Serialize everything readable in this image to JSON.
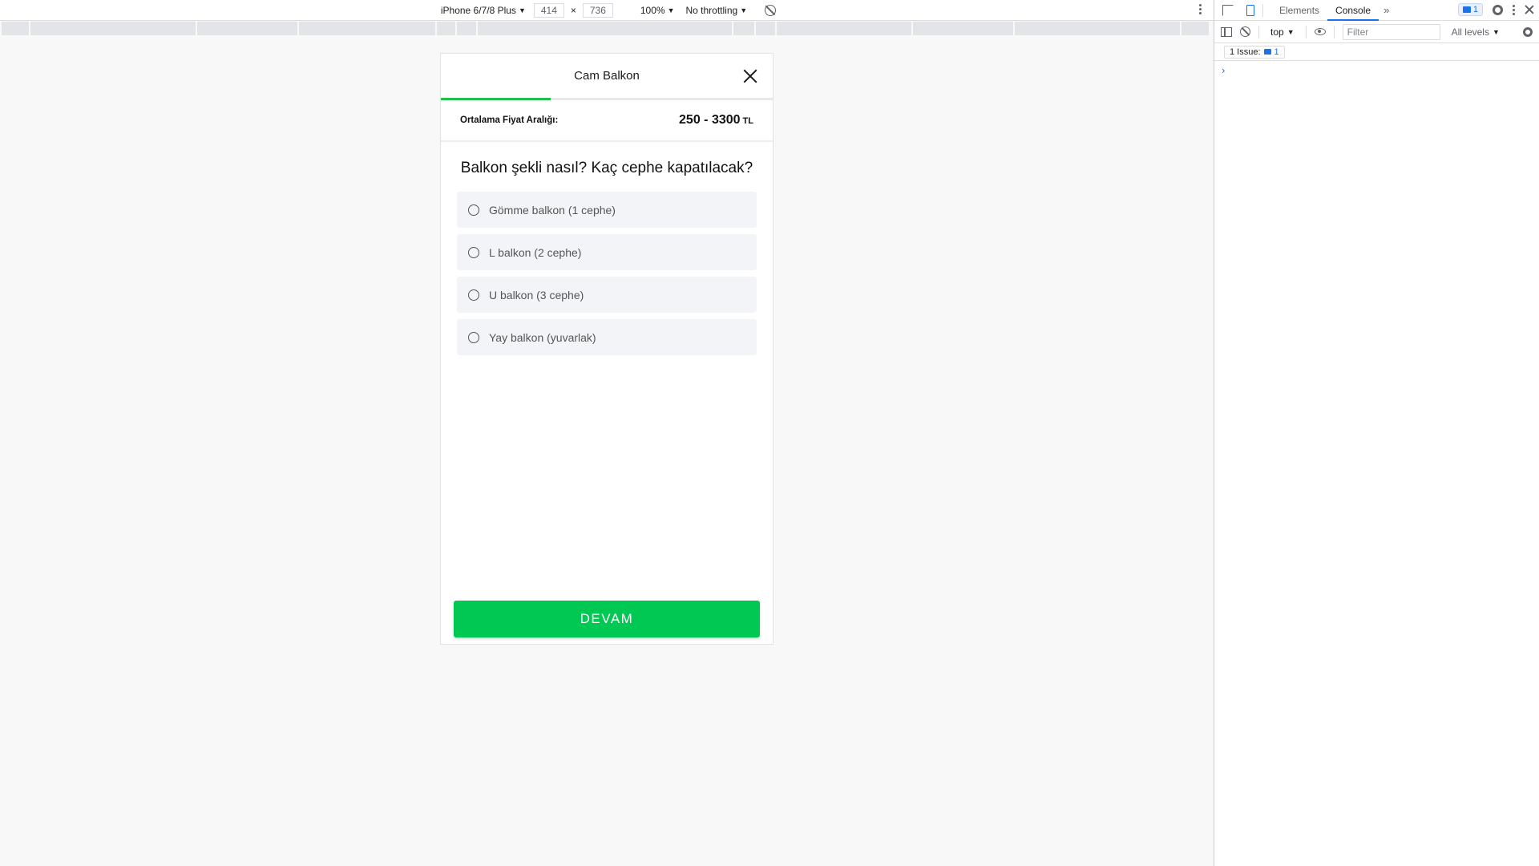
{
  "device_toolbar": {
    "device": "iPhone 6/7/8 Plus",
    "width": "414",
    "times": "×",
    "height": "736",
    "zoom": "100%",
    "throttling": "No throttling"
  },
  "modal": {
    "title": "Cam Balkon",
    "progress_fraction": 0.33,
    "price_label": "Ortalama Fiyat Aralığı:",
    "price_value": "250 - 3300",
    "price_unit": "TL",
    "question": "Balkon şekli nasıl? Kaç cephe kapatılacak?",
    "options": [
      {
        "label": "Gömme balkon (1 cephe)"
      },
      {
        "label": "L balkon (2 cephe)"
      },
      {
        "label": "U balkon (3 cephe)"
      },
      {
        "label": "Yay balkon (yuvarlak)"
      }
    ],
    "continue_label": "DEVAM"
  },
  "devtools": {
    "tabs": [
      {
        "label": "Elements"
      },
      {
        "label": "Console"
      }
    ],
    "issue_badge_count": "1",
    "context": "top",
    "filter_placeholder": "Filter",
    "levels": "All levels",
    "issues_label": "1 Issue:",
    "issues_count": "1",
    "prompt": "›"
  },
  "colors": {
    "accent_green": "#00c853",
    "progress_green": "#1fbf4a",
    "devtools_blue": "#1a73e8"
  }
}
